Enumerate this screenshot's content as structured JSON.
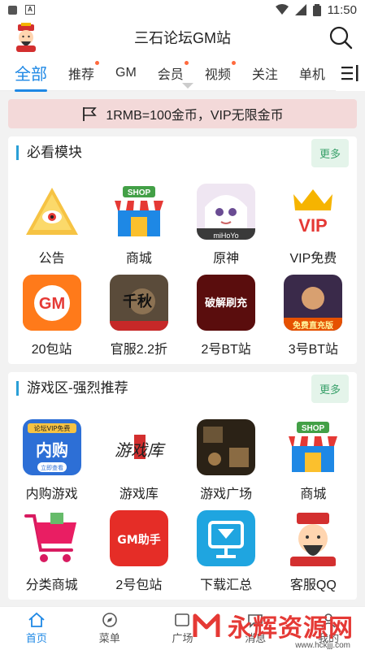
{
  "status_bar": {
    "time": "11:50"
  },
  "header": {
    "title": "三石论坛GM站"
  },
  "tabs": [
    {
      "label": "全部",
      "active": true,
      "dot": false
    },
    {
      "label": "推荐",
      "dot": true
    },
    {
      "label": "GM",
      "dot": false
    },
    {
      "label": "会员",
      "dot": true
    },
    {
      "label": "视频",
      "dot": true
    },
    {
      "label": "关注",
      "dot": false
    },
    {
      "label": "单机",
      "dot": false
    }
  ],
  "notice": {
    "text": "1RMB=100金币，VIP无限金币"
  },
  "sections": [
    {
      "title": "必看模块",
      "more": "更多",
      "items": [
        {
          "label": "公告",
          "icon": "announcement-icon"
        },
        {
          "label": "商城",
          "icon": "shop-icon",
          "badge": "SHOP"
        },
        {
          "label": "原神",
          "icon": "genshin-icon",
          "badge": "miHoYo"
        },
        {
          "label": "VIP免费",
          "icon": "vip-icon",
          "badge": "VIP"
        },
        {
          "label": "20包站",
          "icon": "gm-icon",
          "badge": "GM"
        },
        {
          "label": "官服2.2折",
          "icon": "qianqiu-icon",
          "badge": "千秋"
        },
        {
          "label": "2号BT站",
          "icon": "bt-station-icon",
          "badge": "破解刷充"
        },
        {
          "label": "3号BT站",
          "icon": "bt3-station-icon",
          "badge": "免费直充版"
        }
      ]
    },
    {
      "title": "游戏区-强烈推荐",
      "more": "更多",
      "items": [
        {
          "label": "内购游戏",
          "icon": "neigou-icon",
          "badge": "内购",
          "badge2": "论坛VIP免费",
          "badge3": "立即查看"
        },
        {
          "label": "游戏库",
          "icon": "game-library-icon",
          "badge": "游戏库"
        },
        {
          "label": "游戏广场",
          "icon": "game-plaza-icon"
        },
        {
          "label": "商城",
          "icon": "shop-icon",
          "badge": "SHOP"
        },
        {
          "label": "分类商城",
          "icon": "cart-icon"
        },
        {
          "label": "2号包站",
          "icon": "gm-helper-icon",
          "badge": "GM助手"
        },
        {
          "label": "下载汇总",
          "icon": "download-icon"
        },
        {
          "label": "客服QQ",
          "icon": "service-icon"
        }
      ]
    }
  ],
  "bottom_nav": [
    {
      "label": "首页",
      "icon": "home-icon",
      "active": true
    },
    {
      "label": "菜单",
      "icon": "compass-icon"
    },
    {
      "label": "广场",
      "icon": "plaza-icon"
    },
    {
      "label": "消息",
      "icon": "message-icon"
    },
    {
      "label": "我的",
      "icon": "profile-icon"
    }
  ],
  "watermark": {
    "text": "永辉资源网",
    "url": "www.hckjjj.com"
  },
  "colors": {
    "accent": "#1e88e5",
    "more_bg": "#e4f4ea",
    "more_text": "#39a06a",
    "notice_bg": "#f3d9d9",
    "section_bar": "#2a9fd6"
  }
}
